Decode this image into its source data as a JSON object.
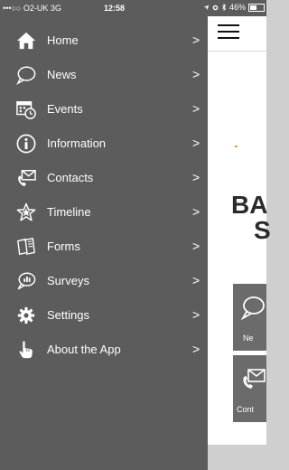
{
  "status_bar": {
    "carrier": "•••○○ O2-UK  3G",
    "time": "12:58",
    "battery": "46%"
  },
  "drawer": {
    "items": [
      {
        "label": "Home",
        "icon": "home-icon"
      },
      {
        "label": "News",
        "icon": "speech-bubble-icon"
      },
      {
        "label": "Events",
        "icon": "calendar-icon"
      },
      {
        "label": "Information",
        "icon": "info-icon"
      },
      {
        "label": "Contacts",
        "icon": "phone-envelope-icon"
      },
      {
        "label": "Timeline",
        "icon": "star-icon"
      },
      {
        "label": "Forms",
        "icon": "forms-icon"
      },
      {
        "label": "Surveys",
        "icon": "survey-bubble-icon"
      },
      {
        "label": "Settings",
        "icon": "gear-icon"
      },
      {
        "label": "About the App",
        "icon": "pointing-hand-icon"
      }
    ],
    "chevron": ">"
  },
  "main": {
    "banner_line1": "BA",
    "banner_line2": "S",
    "tiles": [
      {
        "label": "Ne",
        "icon": "speech-bubble-icon"
      },
      {
        "label": "Cont",
        "icon": "phone-envelope-icon"
      }
    ]
  }
}
